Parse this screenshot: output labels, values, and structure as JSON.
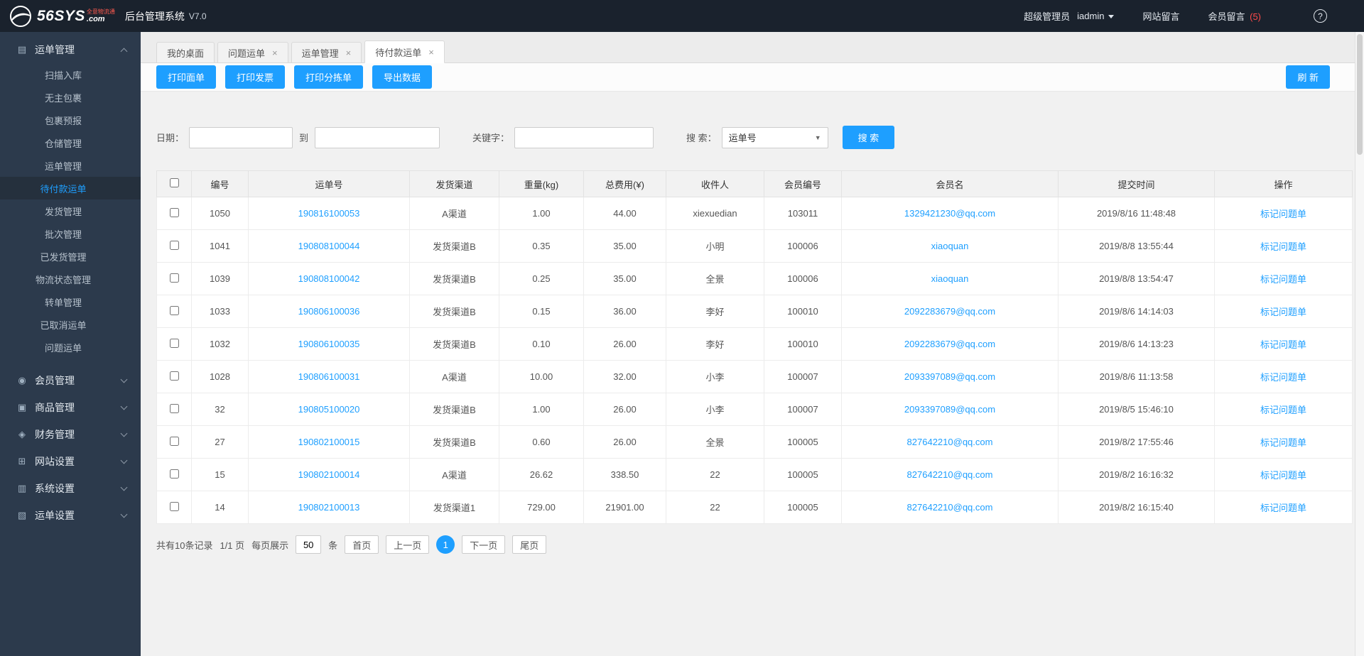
{
  "colors": {
    "accent": "#1E9FFF",
    "danger": "#ff4a4a",
    "header_bg": "#1a222d",
    "sidebar_bg": "#2c3a4c"
  },
  "header": {
    "logo_main": "56SYS",
    "logo_tagline": "全意物流通",
    "logo_domain": ".com",
    "logo_icon": "logo-swoosh-icon",
    "app_title": "后台管理系统",
    "version": "V7.0",
    "role": "超级管理员",
    "username": "iadmin",
    "site_messages": "网站留言",
    "member_messages": "会员留言",
    "member_messages_count": "(5)",
    "help_icon": "help-icon"
  },
  "sidebar": {
    "main_group": {
      "label": "运单管理",
      "icon": "waybill-icon"
    },
    "sub_items": [
      {
        "label": "扫描入库"
      },
      {
        "label": "无主包裹"
      },
      {
        "label": "包裹预报"
      },
      {
        "label": "仓储管理"
      },
      {
        "label": "运单管理"
      },
      {
        "label": "待付款运单",
        "active": true
      },
      {
        "label": "发货管理"
      },
      {
        "label": "批次管理"
      },
      {
        "label": "已发货管理"
      },
      {
        "label": "物流状态管理"
      },
      {
        "label": "转单管理"
      },
      {
        "label": "已取消运单"
      },
      {
        "label": "问题运单"
      }
    ],
    "collapsed_groups": [
      {
        "label": "会员管理",
        "icon": "user-icon"
      },
      {
        "label": "商品管理",
        "icon": "goods-icon"
      },
      {
        "label": "财务管理",
        "icon": "finance-icon"
      },
      {
        "label": "网站设置",
        "icon": "website-icon"
      },
      {
        "label": "系统设置",
        "icon": "system-icon"
      },
      {
        "label": "运单设置",
        "icon": "waybill-settings-icon"
      }
    ]
  },
  "tabs": [
    {
      "label": "我的桌面",
      "closable": false,
      "active": false
    },
    {
      "label": "问题运单",
      "closable": true,
      "active": false
    },
    {
      "label": "运单管理",
      "closable": true,
      "active": false
    },
    {
      "label": "待付款运单",
      "closable": true,
      "active": true
    }
  ],
  "toolbar": {
    "buttons": [
      "打印面单",
      "打印发票",
      "打印分拣单",
      "导出数据"
    ],
    "refresh": "刷 新"
  },
  "filters": {
    "date_label": "日期：",
    "to_label": "到",
    "keyword_label": "关键字：",
    "search_type_label": "搜 索：",
    "search_type_value": "运单号",
    "search_button": "搜 索"
  },
  "table": {
    "columns": [
      "编号",
      "运单号",
      "发货渠道",
      "重量(kg)",
      "总费用(¥)",
      "收件人",
      "会员编号",
      "会员名",
      "提交时间",
      "操作"
    ],
    "rows": [
      {
        "id": "1050",
        "waybill": "190816100053",
        "channel": "A渠道",
        "weight": "1.00",
        "fee": "44.00",
        "recipient": "xiexuedian",
        "member_id": "103011",
        "member_name": "1329421230@qq.com",
        "time": "2019/8/16 11:48:48",
        "action": "标记问题单",
        "active": false
      },
      {
        "id": "1041",
        "waybill": "190808100044",
        "channel": "发货渠道B",
        "weight": "0.35",
        "fee": "35.00",
        "recipient": "小明",
        "member_id": "100006",
        "member_name": "xiaoquan",
        "time": "2019/8/8 13:55:44",
        "action": "标记问题单",
        "active": false
      },
      {
        "id": "1039",
        "waybill": "190808100042",
        "channel": "发货渠道B",
        "weight": "0.25",
        "fee": "35.00",
        "recipient": "全景",
        "member_id": "100006",
        "member_name": "xiaoquan",
        "time": "2019/8/8 13:54:47",
        "action": "标记问题单",
        "active": false
      },
      {
        "id": "1033",
        "waybill": "190806100036",
        "channel": "发货渠道B",
        "weight": "0.15",
        "fee": "36.00",
        "recipient": "李好",
        "member_id": "100010",
        "member_name": "2092283679@qq.com",
        "time": "2019/8/6 14:14:03",
        "action": "标记问题单",
        "active": false
      },
      {
        "id": "1032",
        "waybill": "190806100035",
        "channel": "发货渠道B",
        "weight": "0.10",
        "fee": "26.00",
        "recipient": "李好",
        "member_id": "100010",
        "member_name": "2092283679@qq.com",
        "time": "2019/8/6 14:13:23",
        "action": "标记问题单",
        "active": false
      },
      {
        "id": "1028",
        "waybill": "190806100031",
        "channel": "A渠道",
        "weight": "10.00",
        "fee": "32.00",
        "recipient": "小李",
        "member_id": "100007",
        "member_name": "2093397089@qq.com",
        "time": "2019/8/6 11:13:58",
        "action": "标记问题单",
        "active": false
      },
      {
        "id": "32",
        "waybill": "190805100020",
        "channel": "发货渠道B",
        "weight": "1.00",
        "fee": "26.00",
        "recipient": "小李",
        "member_id": "100007",
        "member_name": "2093397089@qq.com",
        "time": "2019/8/5 15:46:10",
        "action": "标记问题单",
        "active": false
      },
      {
        "id": "27",
        "waybill": "190802100015",
        "channel": "发货渠道B",
        "weight": "0.60",
        "fee": "26.00",
        "recipient": "全景",
        "member_id": "100005",
        "member_name": "827642210@qq.com",
        "time": "2019/8/2 17:55:46",
        "action": "标记问题单",
        "active": false
      },
      {
        "id": "15",
        "waybill": "190802100014",
        "channel": "A渠道",
        "weight": "26.62",
        "fee": "338.50",
        "recipient": "22",
        "member_id": "100005",
        "member_name": "827642210@qq.com",
        "time": "2019/8/2 16:16:32",
        "action": "标记问题单",
        "active": false
      },
      {
        "id": "14",
        "waybill": "190802100013",
        "channel": "发货渠道1",
        "weight": "729.00",
        "fee": "21901.00",
        "recipient": "22",
        "member_id": "100005",
        "member_name": "827642210@qq.com",
        "time": "2019/8/2 16:15:40",
        "action": "标记问题单",
        "active": false
      }
    ]
  },
  "pagination": {
    "summary": "共有10条记录",
    "page_info": "1/1 页",
    "per_page_label": "每页展示",
    "per_page_value": "50",
    "unit": "条",
    "first": "首页",
    "prev": "上一页",
    "current": "1",
    "next": "下一页",
    "last": "尾页"
  }
}
